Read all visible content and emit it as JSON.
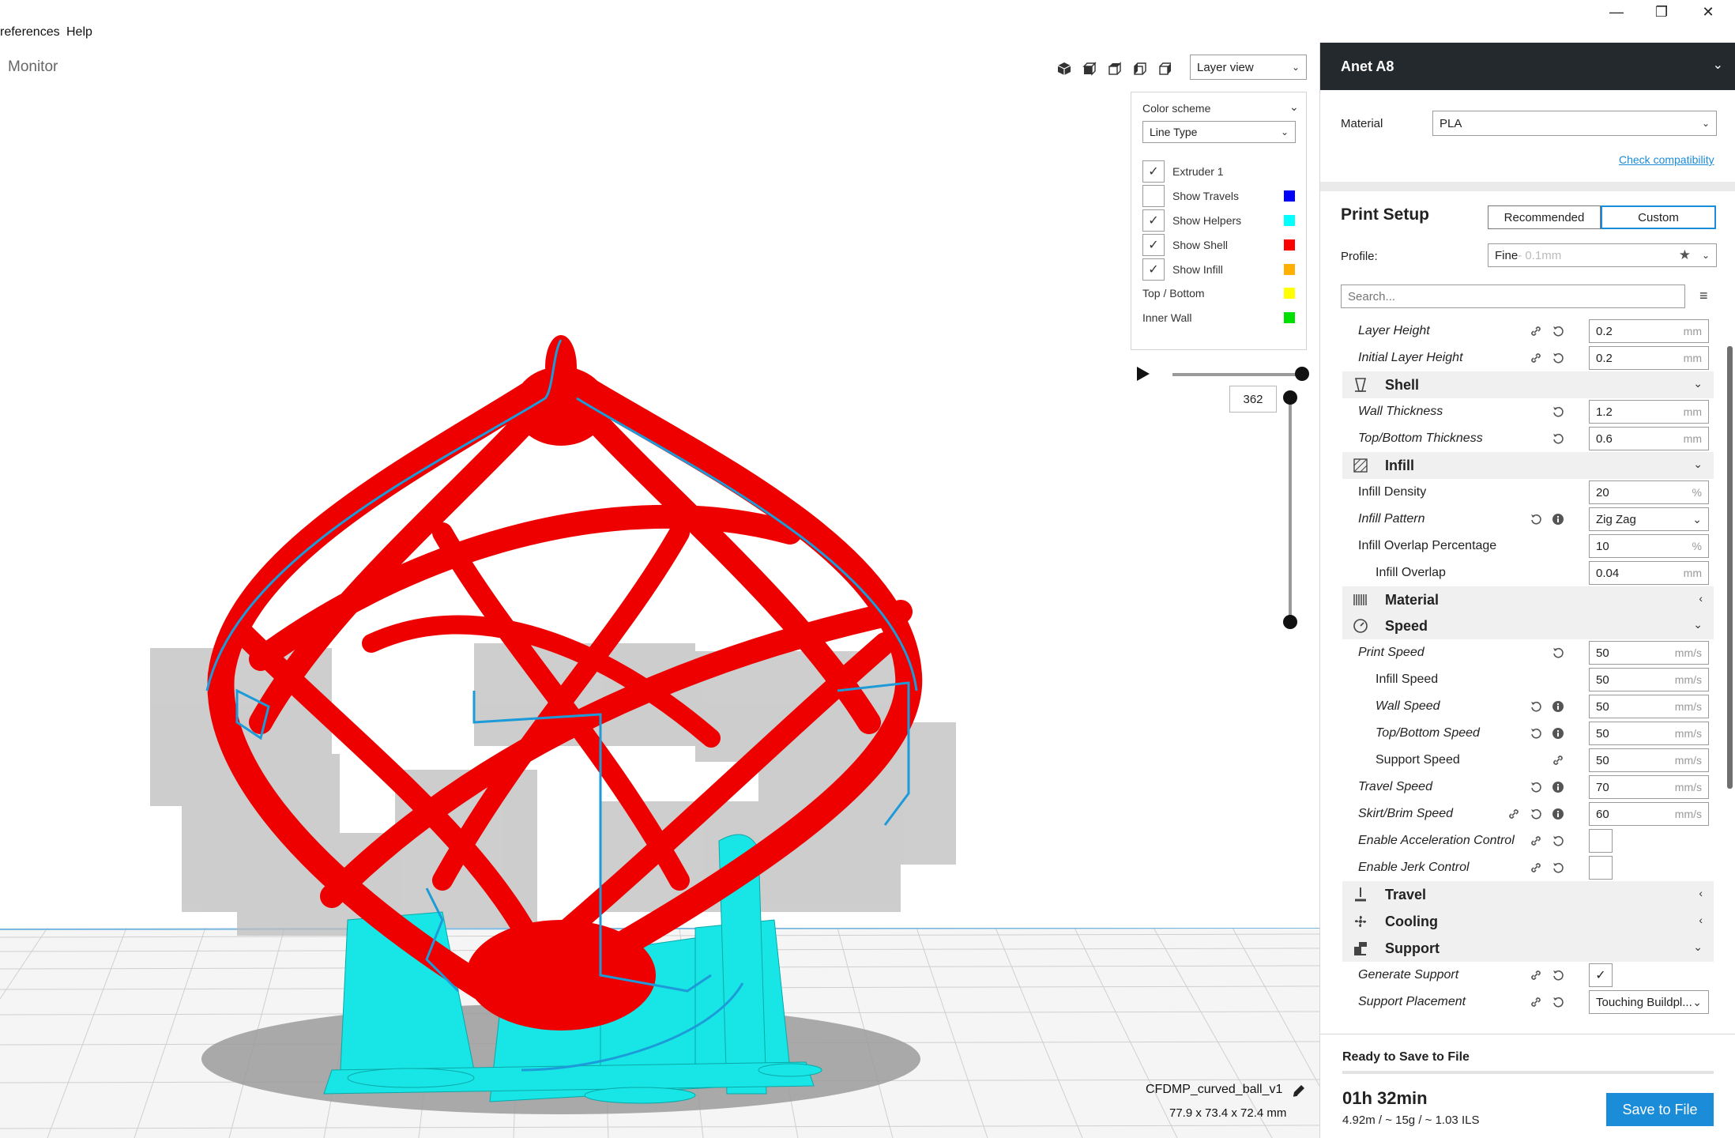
{
  "menu": {
    "preferences_label": "references",
    "help_label": "Help"
  },
  "window_controls": {
    "minimize": "—",
    "maximize": "❐",
    "close": "✕"
  },
  "viewport": {
    "stage_tab": "Monitor",
    "view_mode": "Layer view",
    "legend": {
      "color_scheme_label": "Color scheme",
      "color_scheme_value": "Line Type",
      "items": [
        {
          "label": "Extruder 1",
          "checked": true,
          "color": ""
        },
        {
          "label": "Show Travels",
          "checked": false,
          "color": "#0000ff"
        },
        {
          "label": "Show Helpers",
          "checked": true,
          "color": "#00ffff"
        },
        {
          "label": "Show Shell",
          "checked": true,
          "color": "#ff0000"
        },
        {
          "label": "Show Infill",
          "checked": true,
          "color": "#ffb000"
        },
        {
          "label": "Top / Bottom",
          "checked": null,
          "color": "#ffff00"
        },
        {
          "label": "Inner Wall",
          "checked": null,
          "color": "#00e000"
        }
      ]
    },
    "current_layer": "362",
    "object_name": "CFDMP_curved_ball_v1",
    "object_dims": "77.9 x 73.4 x 72.4 mm"
  },
  "sidebar": {
    "machine_name": "Anet A8",
    "material_label": "Material",
    "material_value": "PLA",
    "check_compat": "Check compatibility",
    "print_setup_title": "Print Setup",
    "mode_recommended": "Recommended",
    "mode_custom": "Custom",
    "profile_label": "Profile:",
    "profile_value": "Fine",
    "profile_suffix": " - 0.1mm",
    "search_placeholder": "Search...",
    "settings": [
      {
        "kind": "setting",
        "label": "Layer Height",
        "italic": true,
        "indent": 0,
        "value": "0.2",
        "unit": "mm",
        "icons": [
          "link-icon",
          "reset-icon"
        ]
      },
      {
        "kind": "setting",
        "label": "Initial Layer Height",
        "italic": true,
        "indent": 0,
        "value": "0.2",
        "unit": "mm",
        "icons": [
          "link-icon",
          "reset-icon"
        ]
      },
      {
        "kind": "category",
        "label": "Shell",
        "icon": "shell-icon",
        "expanded": true
      },
      {
        "kind": "setting",
        "label": "Wall Thickness",
        "italic": true,
        "indent": 0,
        "value": "1.2",
        "unit": "mm",
        "icons": [
          "reset-icon"
        ]
      },
      {
        "kind": "setting",
        "label": "Top/Bottom Thickness",
        "italic": true,
        "indent": 0,
        "value": "0.6",
        "unit": "mm",
        "icons": [
          "reset-icon"
        ]
      },
      {
        "kind": "category",
        "label": "Infill",
        "icon": "infill-icon",
        "expanded": true
      },
      {
        "kind": "setting",
        "label": "Infill Density",
        "italic": false,
        "indent": 0,
        "value": "20",
        "unit": "%",
        "icons": []
      },
      {
        "kind": "setting",
        "label": "Infill Pattern",
        "italic": true,
        "indent": 0,
        "value": "Zig Zag",
        "unit": "⌄",
        "select": true,
        "icons": [
          "reset-icon",
          "info-icon"
        ]
      },
      {
        "kind": "setting",
        "label": "Infill Overlap Percentage",
        "italic": false,
        "indent": 0,
        "value": "10",
        "unit": "%",
        "icons": []
      },
      {
        "kind": "setting",
        "label": "Infill Overlap",
        "italic": false,
        "indent": 1,
        "value": "0.04",
        "unit": "mm",
        "icons": []
      },
      {
        "kind": "category",
        "label": "Material",
        "icon": "material-icon",
        "expanded": false
      },
      {
        "kind": "category",
        "label": "Speed",
        "icon": "speed-icon",
        "expanded": true
      },
      {
        "kind": "setting",
        "label": "Print Speed",
        "italic": true,
        "indent": 0,
        "value": "50",
        "unit": "mm/s",
        "icons": [
          "reset-icon"
        ]
      },
      {
        "kind": "setting",
        "label": "Infill Speed",
        "italic": false,
        "indent": 1,
        "value": "50",
        "unit": "mm/s",
        "icons": []
      },
      {
        "kind": "setting",
        "label": "Wall Speed",
        "italic": true,
        "indent": 1,
        "value": "50",
        "unit": "mm/s",
        "icons": [
          "reset-icon",
          "info-icon"
        ]
      },
      {
        "kind": "setting",
        "label": "Top/Bottom Speed",
        "italic": true,
        "indent": 1,
        "value": "50",
        "unit": "mm/s",
        "icons": [
          "reset-icon",
          "info-icon"
        ]
      },
      {
        "kind": "setting",
        "label": "Support Speed",
        "italic": false,
        "indent": 1,
        "value": "50",
        "unit": "mm/s",
        "icons": [
          "link-icon"
        ]
      },
      {
        "kind": "setting",
        "label": "Travel Speed",
        "italic": true,
        "indent": 0,
        "value": "70",
        "unit": "mm/s",
        "icons": [
          "reset-icon",
          "info-icon"
        ]
      },
      {
        "kind": "setting",
        "label": "Skirt/Brim Speed",
        "italic": true,
        "indent": 0,
        "value": "60",
        "unit": "mm/s",
        "icons": [
          "link-icon",
          "reset-icon",
          "info-icon"
        ]
      },
      {
        "kind": "check",
        "label": "Enable Acceleration Control",
        "italic": true,
        "indent": 0,
        "checked": false,
        "icons": [
          "link-icon",
          "reset-icon"
        ]
      },
      {
        "kind": "check",
        "label": "Enable Jerk Control",
        "italic": true,
        "indent": 0,
        "checked": false,
        "icons": [
          "link-icon",
          "reset-icon"
        ]
      },
      {
        "kind": "category",
        "label": "Travel",
        "icon": "travel-icon",
        "expanded": false
      },
      {
        "kind": "category",
        "label": "Cooling",
        "icon": "cooling-icon",
        "expanded": false
      },
      {
        "kind": "category",
        "label": "Support",
        "icon": "support-icon",
        "expanded": true
      },
      {
        "kind": "check",
        "label": "Generate Support",
        "italic": true,
        "indent": 0,
        "checked": true,
        "icons": [
          "link-icon",
          "reset-icon"
        ]
      },
      {
        "kind": "setting",
        "label": "Support Placement",
        "italic": true,
        "indent": 0,
        "value": "Touching Buildpl...",
        "unit": "⌄",
        "select": true,
        "icons": [
          "link-icon",
          "reset-icon"
        ]
      }
    ],
    "bottom": {
      "ready": "Ready to Save to File",
      "time": "01h 32min",
      "stats": "4.92m / ~ 15g / ~ 1.03 ILS",
      "save_label": "Save to File"
    }
  }
}
